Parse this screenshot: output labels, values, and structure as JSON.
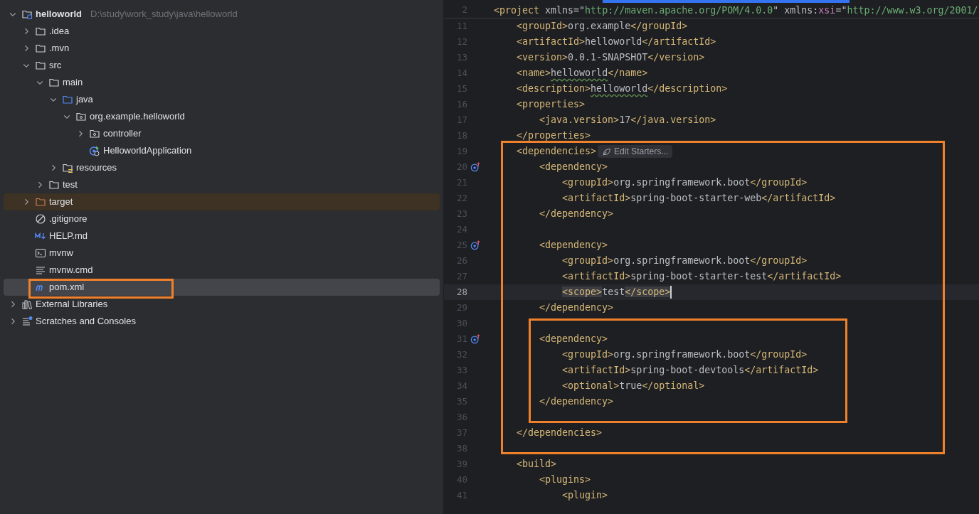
{
  "project_tree": [
    {
      "label": "helloworld",
      "kind": "project",
      "path": "D:\\study\\work_study\\java\\helloworld",
      "expanded": true,
      "selected": false,
      "children": [
        {
          "label": ".idea",
          "kind": "folder",
          "expanded": false,
          "selected": false
        },
        {
          "label": ".mvn",
          "kind": "folder",
          "expanded": false,
          "selected": false
        },
        {
          "label": "src",
          "kind": "folder",
          "expanded": true,
          "selected": false,
          "children": [
            {
              "label": "main",
              "kind": "folder",
              "expanded": true,
              "selected": false,
              "children": [
                {
                  "label": "java",
                  "kind": "source_root",
                  "expanded": true,
                  "selected": false,
                  "children": [
                    {
                      "label": "org.example.helloworld",
                      "kind": "package",
                      "expanded": true,
                      "selected": false,
                      "children": [
                        {
                          "label": "controller",
                          "kind": "package",
                          "expanded": false,
                          "selected": false
                        },
                        {
                          "label": "HelloworldApplication",
                          "kind": "spring_class",
                          "selected": false
                        }
                      ]
                    }
                  ]
                },
                {
                  "label": "resources",
                  "kind": "resources_root",
                  "expanded": false,
                  "selected": false
                }
              ]
            },
            {
              "label": "test",
              "kind": "folder",
              "expanded": false,
              "selected": false
            }
          ]
        },
        {
          "label": "target",
          "kind": "excluded",
          "expanded": false,
          "selected": false
        },
        {
          "label": ".gitignore",
          "kind": "ignore",
          "selected": false
        },
        {
          "label": "HELP.md",
          "kind": "markdown",
          "selected": false
        },
        {
          "label": "mvnw",
          "kind": "shell",
          "selected": false
        },
        {
          "label": "mvnw.cmd",
          "kind": "text",
          "selected": false
        },
        {
          "label": "pom.xml",
          "kind": "maven",
          "selected": true
        }
      ]
    },
    {
      "label": "External Libraries",
      "kind": "libraries",
      "expanded": false,
      "selected": false
    },
    {
      "label": "Scratches and Consoles",
      "kind": "scratches",
      "expanded": false,
      "selected": false
    }
  ],
  "editor": {
    "sticky_line": {
      "number": "2",
      "segments": [
        {
          "kind": "tag",
          "text": "<project "
        },
        {
          "kind": "attr",
          "text": "xmlns=\""
        },
        {
          "kind": "value",
          "text": "http://maven.apache.org/POM/4.0.0"
        },
        {
          "kind": "attr",
          "text": "\" xmlns:"
        },
        {
          "kind": "ns",
          "text": "xsi"
        },
        {
          "kind": "attr",
          "text": "=\""
        },
        {
          "kind": "value",
          "text": "http://www.w3.org/2001/"
        }
      ]
    },
    "lines": [
      {
        "number": "11",
        "segments": [
          {
            "kind": "tag",
            "text": "    <groupId>"
          },
          {
            "kind": "text",
            "text": "org.example"
          },
          {
            "kind": "tag",
            "text": "</groupId>"
          }
        ]
      },
      {
        "number": "12",
        "segments": [
          {
            "kind": "tag",
            "text": "    <artifactId>"
          },
          {
            "kind": "text",
            "text": "helloworld"
          },
          {
            "kind": "tag",
            "text": "</artifactId>"
          }
        ]
      },
      {
        "number": "13",
        "segments": [
          {
            "kind": "tag",
            "text": "    <version>"
          },
          {
            "kind": "text",
            "text": "0.0.1-SNAPSHOT"
          },
          {
            "kind": "tag",
            "text": "</version>"
          }
        ]
      },
      {
        "number": "14",
        "segments": [
          {
            "kind": "tag",
            "text": "    <name>"
          },
          {
            "kind": "typo",
            "text": "helloworld"
          },
          {
            "kind": "tag",
            "text": "</name>"
          }
        ]
      },
      {
        "number": "15",
        "segments": [
          {
            "kind": "tag",
            "text": "    <description>"
          },
          {
            "kind": "typo",
            "text": "helloworld"
          },
          {
            "kind": "tag",
            "text": "</description>"
          }
        ]
      },
      {
        "number": "16",
        "segments": [
          {
            "kind": "tag",
            "text": "    <properties>"
          }
        ]
      },
      {
        "number": "17",
        "segments": [
          {
            "kind": "tag",
            "text": "        <java.version>"
          },
          {
            "kind": "text",
            "text": "17"
          },
          {
            "kind": "tag",
            "text": "</java.version>"
          }
        ]
      },
      {
        "number": "18",
        "segments": [
          {
            "kind": "tag",
            "text": "    </properties>"
          }
        ]
      },
      {
        "number": "19",
        "segments": [
          {
            "kind": "tag",
            "text": "    <dependencies>"
          }
        ],
        "hint": "Edit Starters..."
      },
      {
        "number": "20",
        "marker": true,
        "segments": [
          {
            "kind": "tag",
            "text": "        <dependency>"
          }
        ]
      },
      {
        "number": "21",
        "segments": [
          {
            "kind": "tag",
            "text": "            <groupId>"
          },
          {
            "kind": "text",
            "text": "org.springframework.boot"
          },
          {
            "kind": "tag",
            "text": "</groupId>"
          }
        ]
      },
      {
        "number": "22",
        "segments": [
          {
            "kind": "tag",
            "text": "            <artifactId>"
          },
          {
            "kind": "text",
            "text": "spring-boot-starter-web"
          },
          {
            "kind": "tag",
            "text": "</artifactId>"
          }
        ]
      },
      {
        "number": "23",
        "segments": [
          {
            "kind": "tag",
            "text": "        </dependency>"
          }
        ]
      },
      {
        "number": "24"
      },
      {
        "number": "25",
        "marker": true,
        "segments": [
          {
            "kind": "tag",
            "text": "        <dependency>"
          }
        ]
      },
      {
        "number": "26",
        "segments": [
          {
            "kind": "tag",
            "text": "            <groupId>"
          },
          {
            "kind": "text",
            "text": "org.springframework.boot"
          },
          {
            "kind": "tag",
            "text": "</groupId>"
          }
        ]
      },
      {
        "number": "27",
        "segments": [
          {
            "kind": "tag",
            "text": "            <artifactId>"
          },
          {
            "kind": "text",
            "text": "spring-boot-starter-test"
          },
          {
            "kind": "tag",
            "text": "</artifactId>"
          }
        ]
      },
      {
        "number": "28",
        "current": true,
        "caret": true,
        "segments": [
          {
            "kind": "match",
            "text": "            <scope>"
          },
          {
            "kind": "text",
            "text": "test"
          },
          {
            "kind": "match",
            "text": "</scope>"
          }
        ]
      },
      {
        "number": "29",
        "segments": [
          {
            "kind": "tag",
            "text": "        </dependency>"
          }
        ]
      },
      {
        "number": "30"
      },
      {
        "number": "31",
        "marker": true,
        "segments": [
          {
            "kind": "tag",
            "text": "        <dependency>"
          }
        ]
      },
      {
        "number": "32",
        "segments": [
          {
            "kind": "tag",
            "text": "            <groupId>"
          },
          {
            "kind": "text",
            "text": "org.springframework.boot"
          },
          {
            "kind": "tag",
            "text": "</groupId>"
          }
        ]
      },
      {
        "number": "33",
        "segments": [
          {
            "kind": "tag",
            "text": "            <artifactId>"
          },
          {
            "kind": "text",
            "text": "spring-boot-devtools"
          },
          {
            "kind": "tag",
            "text": "</artifactId>"
          }
        ]
      },
      {
        "number": "34",
        "segments": [
          {
            "kind": "tag",
            "text": "            <optional>"
          },
          {
            "kind": "text",
            "text": "true"
          },
          {
            "kind": "tag",
            "text": "</optional>"
          }
        ]
      },
      {
        "number": "35",
        "segments": [
          {
            "kind": "tag",
            "text": "        </dependency>"
          }
        ]
      },
      {
        "number": "36"
      },
      {
        "number": "37",
        "segments": [
          {
            "kind": "tag",
            "text": "    </dependencies>"
          }
        ]
      },
      {
        "number": "38"
      },
      {
        "number": "39",
        "segments": [
          {
            "kind": "tag",
            "text": "    <build>"
          }
        ]
      },
      {
        "number": "40",
        "segments": [
          {
            "kind": "tag",
            "text": "        <plugins>"
          }
        ]
      },
      {
        "number": "41",
        "segments": [
          {
            "kind": "tag",
            "text": "            <plugin>"
          }
        ]
      }
    ]
  }
}
